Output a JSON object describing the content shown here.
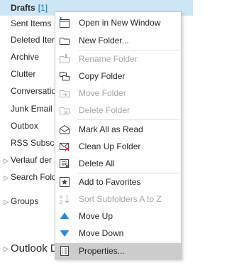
{
  "folders": [
    {
      "name": "Drafts",
      "count": "[1]"
    },
    {
      "name": "Sent Items"
    },
    {
      "name": "Deleted Iter"
    },
    {
      "name": "Archive"
    },
    {
      "name": "Clutter"
    },
    {
      "name": "Conversatio"
    },
    {
      "name": "Junk Email",
      "count": "["
    },
    {
      "name": "Outbox"
    },
    {
      "name": "RSS Subscrip"
    },
    {
      "name": "Verlauf der U"
    },
    {
      "name": "Search Fold"
    },
    {
      "name": "Groups"
    },
    {
      "name": "Outlook D"
    }
  ],
  "menu": {
    "items": [
      {
        "label": "Open in New Window",
        "icon": "open-new-window-icon"
      },
      {
        "label": "New Folder...",
        "icon": "new-folder-icon"
      },
      {
        "label": "Rename Folder",
        "icon": "rename-folder-icon",
        "disabled": true
      },
      {
        "label": "Copy Folder",
        "icon": "copy-folder-icon"
      },
      {
        "label": "Move Folder",
        "icon": "move-folder-icon",
        "disabled": true
      },
      {
        "label": "Delete Folder",
        "icon": "delete-folder-icon",
        "disabled": true
      },
      {
        "label": "Mark All as Read",
        "icon": "mark-all-read-icon"
      },
      {
        "label": "Clean Up Folder",
        "icon": "clean-up-folder-icon"
      },
      {
        "label": "Delete All",
        "icon": "delete-all-icon"
      },
      {
        "label": "Add to Favorites",
        "icon": "add-to-favorites-icon"
      },
      {
        "label": "Sort Subfolders A to Z",
        "icon": "sort-a-to-z-icon",
        "disabled": true
      },
      {
        "label": "Move Up",
        "icon": "move-up-icon"
      },
      {
        "label": "Move Down",
        "icon": "move-down-icon"
      },
      {
        "label": "Properties...",
        "icon": "properties-icon"
      }
    ]
  },
  "colors": {
    "accent": "#0f6cbd",
    "selected_folder": "#cde6f7",
    "menu_hover": "#cccccc",
    "disabled_text": "#a6a6a6"
  }
}
